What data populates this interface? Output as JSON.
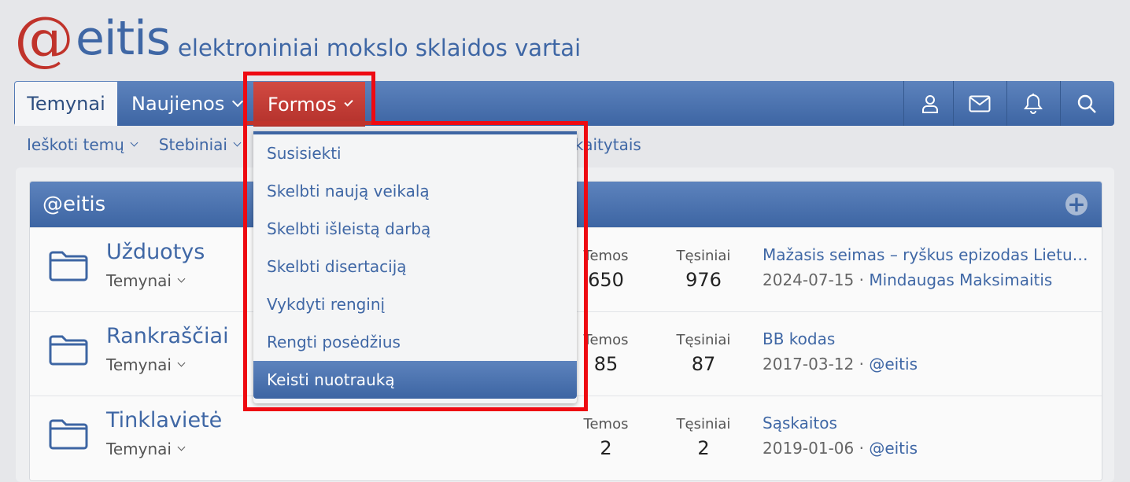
{
  "logo": {
    "at": "@",
    "name": "eitis",
    "tagline": "elektroniniai mokslo sklaidos vartai"
  },
  "nav": {
    "tabs": [
      {
        "label": "Temynai"
      },
      {
        "label": "Naujienos"
      },
      {
        "label": "Formos"
      }
    ],
    "icons": [
      "user-icon",
      "mail-icon",
      "bell-icon",
      "search-icon"
    ]
  },
  "subnav": {
    "items": [
      {
        "label": "Ieškoti temų"
      },
      {
        "label": "Stebiniai"
      }
    ],
    "tail": "kaitytais"
  },
  "dropdown": {
    "items": [
      "Susisiekti",
      "Skelbti naują veikalą",
      "Skelbti išleistą darbą",
      "Skelbti disertaciją",
      "Vykdyti renginį",
      "Rengti posėdžius",
      "Keisti nuotrauką"
    ],
    "selected_index": 6
  },
  "block": {
    "title": "@eitis",
    "nodes": [
      {
        "title": "Užduotys",
        "sub": "Temynai",
        "temos_label": "Temos",
        "temos": "650",
        "tesiniai_label": "Tęsiniai",
        "tesiniai": "976",
        "last_title": "Mažasis seimas – ryškus epizodas Lietuvos istorijoje",
        "last_date": "2024-07-15",
        "last_user": "Mindaugas Maksimaitis"
      },
      {
        "title": "Rankraščiai",
        "sub": "Temynai",
        "temos_label": "Temos",
        "temos": "85",
        "tesiniai_label": "Tęsiniai",
        "tesiniai": "87",
        "last_title": "BB kodas",
        "last_date": "2017-03-12",
        "last_user": "@eitis"
      },
      {
        "title": "Tinklavietė",
        "sub": "Temynai",
        "temos_label": "Temos",
        "temos": "2",
        "tesiniai_label": "Tęsiniai",
        "tesiniai": "2",
        "last_title": "Sąskaitos",
        "last_date": "2019-01-06",
        "last_user": "@eitis"
      }
    ]
  },
  "colors": {
    "brand_blue": "#3f67a5",
    "brand_red": "#c0332b",
    "highlight": "#ee0a12"
  }
}
